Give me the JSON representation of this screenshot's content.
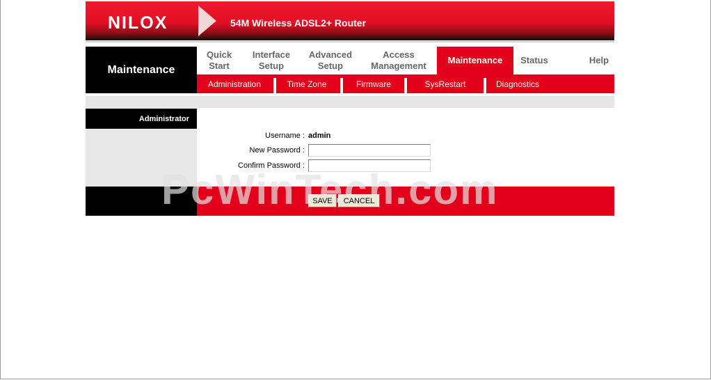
{
  "banner": {
    "logo_text": "NILOX",
    "product": "54M Wireless ADSL2+ Router"
  },
  "section_title": "Maintenance",
  "nav": {
    "items": [
      {
        "label_line1": "Quick",
        "label_line2": "Start"
      },
      {
        "label_line1": "Interface",
        "label_line2": "Setup"
      },
      {
        "label_line1": "Advanced",
        "label_line2": "Setup"
      },
      {
        "label_line1": "Access",
        "label_line2": "Management"
      },
      {
        "label_line1": "Maintenance",
        "label_line2": ""
      },
      {
        "label_line1": "Status",
        "label_line2": ""
      },
      {
        "label_line1": "Help",
        "label_line2": ""
      }
    ],
    "active": "Maintenance"
  },
  "subnav": {
    "items": [
      "Administration",
      "Time Zone",
      "Firmware",
      "SysRestart",
      "Diagnostics"
    ]
  },
  "content": {
    "left_heading": "Administrator",
    "username_label": "Username :",
    "username_value": "admin",
    "new_password_label": "New Password :",
    "new_password_value": "",
    "confirm_password_label": "Confirm Password :",
    "confirm_password_value": ""
  },
  "buttons": {
    "save": "SAVE",
    "cancel": "CANCEL"
  },
  "watermark": "PcWinTech.com",
  "colors": {
    "accent_red": "#e3001b",
    "black": "#000000",
    "grey": "#e6e6e6"
  }
}
